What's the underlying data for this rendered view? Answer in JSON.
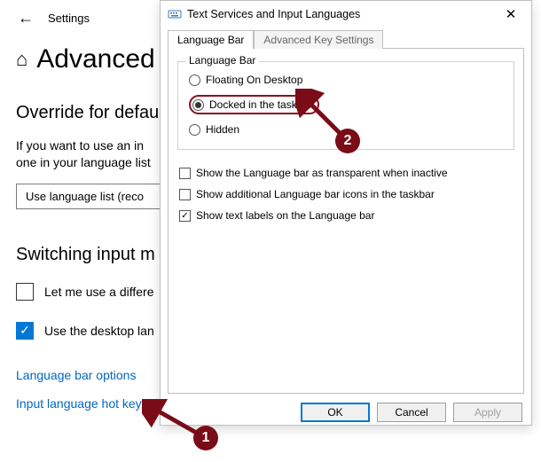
{
  "settings": {
    "caption": "Settings",
    "title": "Advanced",
    "sections": {
      "override": {
        "heading": "Override for defau",
        "desc_line1": "If you want to use an in",
        "desc_line2": "one in your language list",
        "dropdown_value": "Use language list (reco"
      },
      "switching": {
        "heading": "Switching input m",
        "chk1_label": "Let me use a differe",
        "chk1_checked": false,
        "chk2_label": "Use the desktop lan",
        "chk2_checked": true
      }
    },
    "links": {
      "lang_bar": "Language bar options",
      "hot_keys": "Input language hot keys"
    }
  },
  "dialog": {
    "title": "Text Services and Input Languages",
    "tabs": {
      "t1": "Language Bar",
      "t2": "Advanced Key Settings"
    },
    "group_legend": "Language Bar",
    "radios": {
      "floating": "Floating On Desktop",
      "docked": "Docked in the taskbar",
      "hidden": "Hidden",
      "selected": "docked"
    },
    "checks": {
      "transparent": {
        "label": "Show the Language bar as transparent when inactive",
        "checked": false
      },
      "additional": {
        "label": "Show additional Language bar icons in the taskbar",
        "checked": false
      },
      "textlabels": {
        "label": "Show text labels on the Language bar",
        "checked": true
      }
    },
    "buttons": {
      "ok": "OK",
      "cancel": "Cancel",
      "apply": "Apply"
    }
  },
  "annotations": {
    "badge1": "1",
    "badge2": "2"
  }
}
